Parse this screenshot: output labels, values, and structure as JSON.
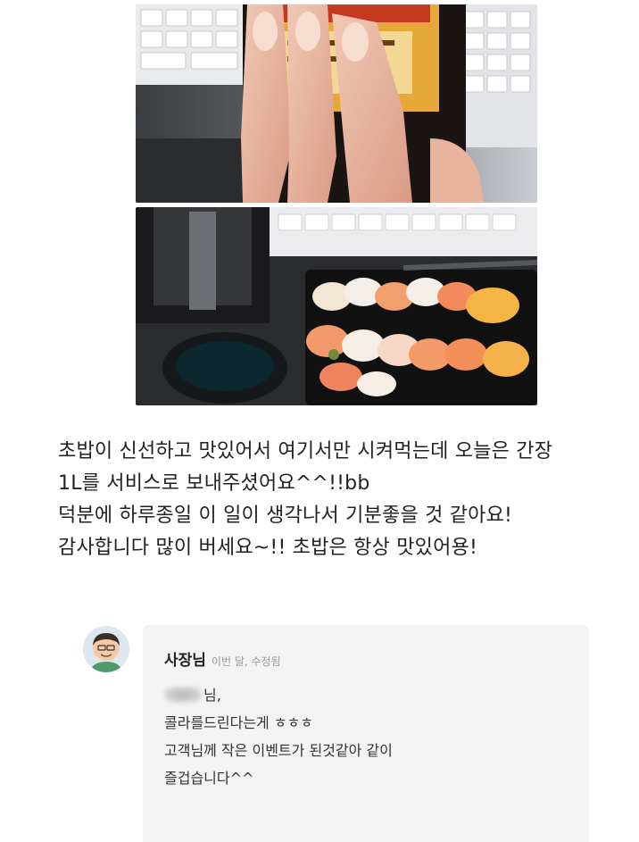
{
  "photos": [
    {
      "name": "soy-sauce-bottle-in-hand"
    },
    {
      "name": "sushi-box-on-desk"
    }
  ],
  "review": {
    "lines": [
      "초밥이 신선하고 맛있어서 여기서만 시켜먹는데 오늘은 간장",
      "1L를 서비스로 보내주셨어요^^!!bb",
      "덕분에 하루종일 이 일이 생각나서 기분좋을 것 같아요!",
      "감사합니다 많이 버세요~!! 초밥은 항상 맛있어용!"
    ]
  },
  "reply": {
    "author": "사장님",
    "meta": "이번 달, 수정됨",
    "greeting_suffix": "님,",
    "lines": [
      "콜라를드린다는게 ㅎㅎㅎ",
      "고객님께 작은 이벤트가 된것같아 같이",
      "즐겁습니다^^"
    ]
  },
  "colors": {
    "reply_background": "#f3f3f3",
    "meta_text": "#9a9a9a"
  }
}
